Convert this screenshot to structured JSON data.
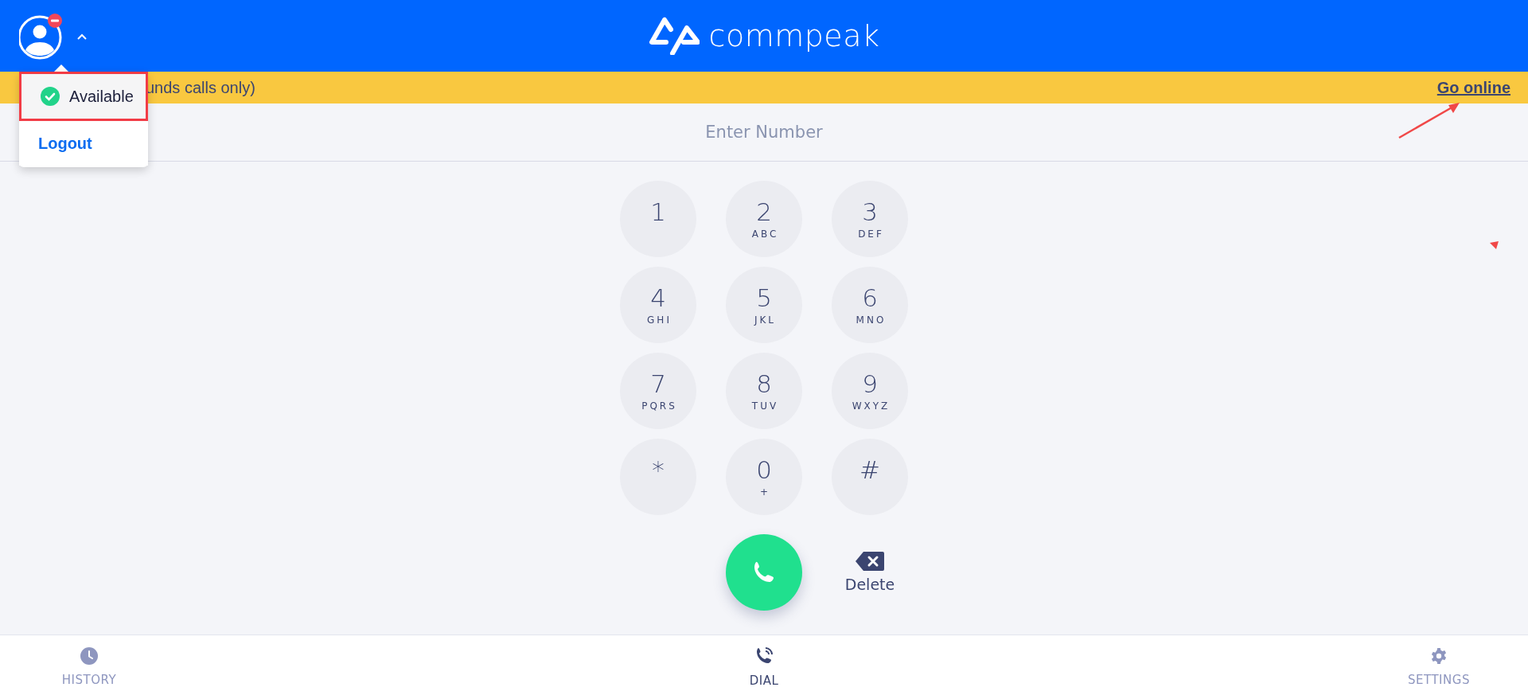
{
  "header": {
    "logo": "commpeak"
  },
  "status_menu": {
    "expanded": true,
    "items": [
      {
        "label": "Available",
        "kind": "status",
        "selected": true
      },
      {
        "label": "Logout",
        "kind": "action",
        "selected": false
      }
    ]
  },
  "banner": {
    "text": "unds calls only)",
    "link": "Go online"
  },
  "dialer": {
    "placeholder": "Enter Number",
    "keys": [
      {
        "digit": "1"
      },
      {
        "digit": "2",
        "letters": "ABC"
      },
      {
        "digit": "3",
        "letters": "DEF"
      },
      {
        "digit": "4",
        "letters": "GHI"
      },
      {
        "digit": "5",
        "letters": "JKL"
      },
      {
        "digit": "6",
        "letters": "MNO"
      },
      {
        "digit": "7",
        "letters": "PQRS"
      },
      {
        "digit": "8",
        "letters": "TUV"
      },
      {
        "digit": "9",
        "letters": "WXYZ"
      },
      {
        "digit": "*"
      },
      {
        "digit": "0",
        "letters": "+"
      },
      {
        "digit": "#"
      }
    ],
    "delete_label": "Delete"
  },
  "nav": [
    {
      "label": "HISTORY",
      "kind": "history",
      "selected": false
    },
    {
      "label": "DIAL",
      "kind": "dial",
      "selected": true
    },
    {
      "label": "SETTINGS",
      "kind": "settings",
      "selected": false
    }
  ]
}
